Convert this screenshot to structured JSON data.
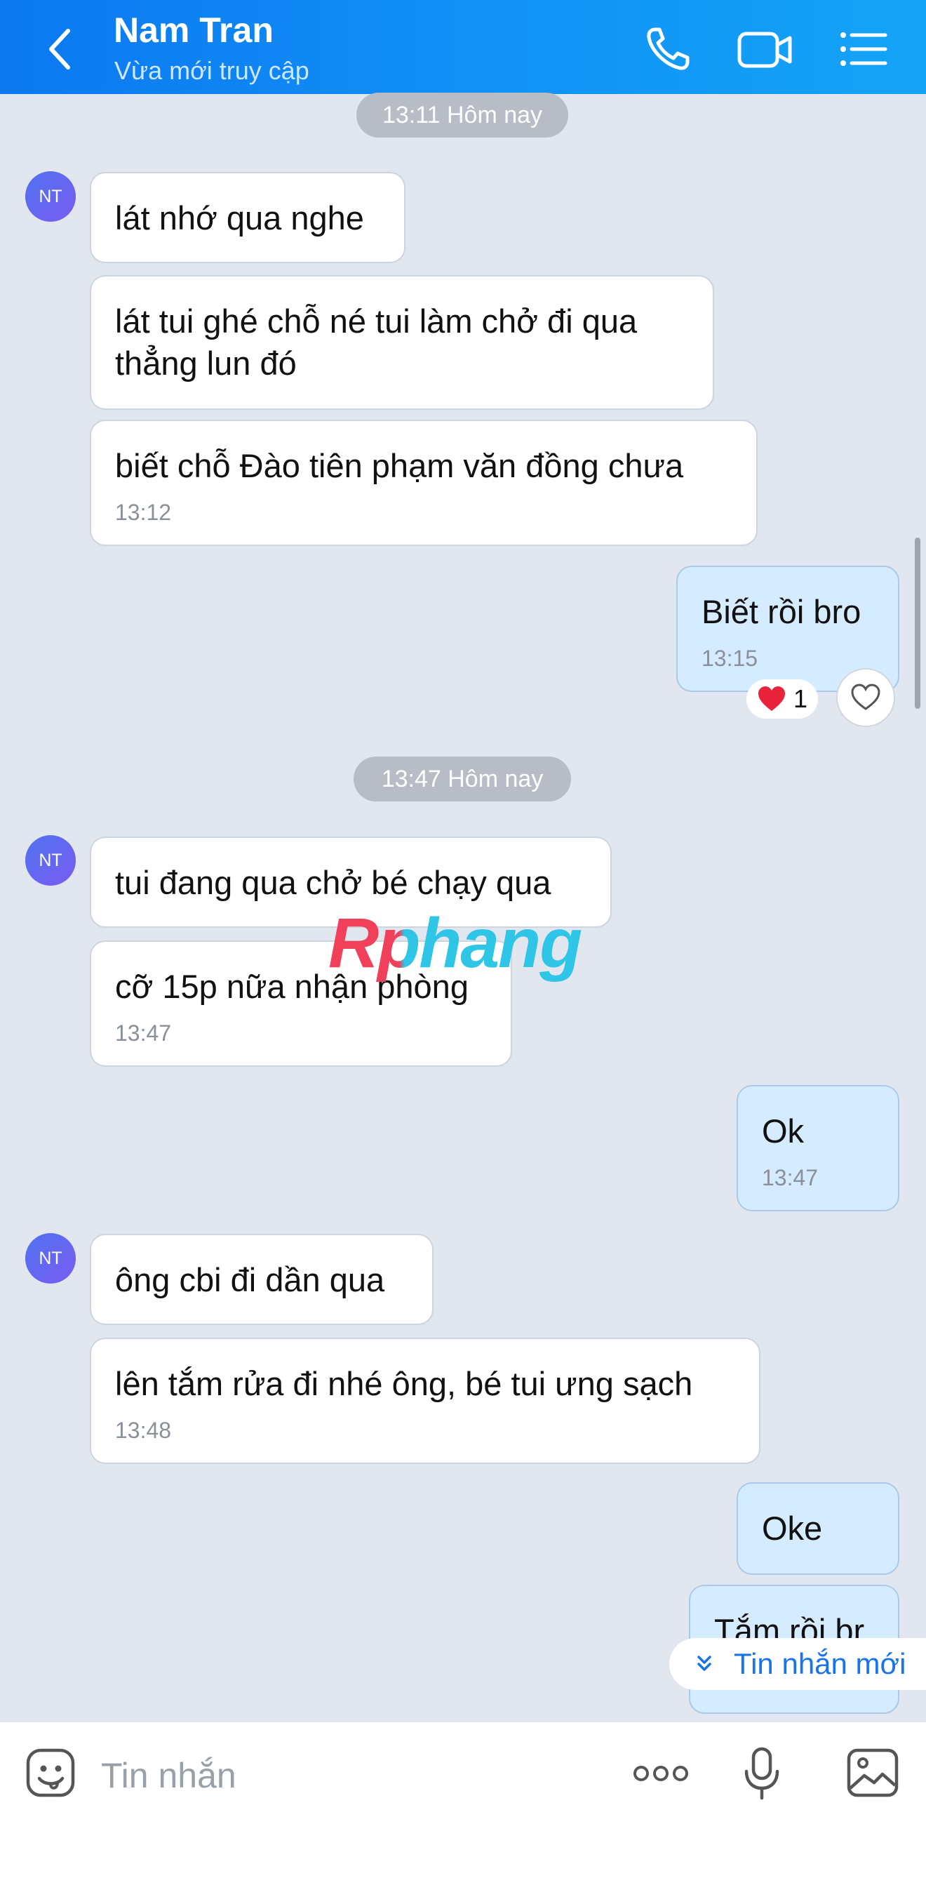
{
  "header": {
    "contact_name": "Nam Tran",
    "status": "Vừa mới truy cập",
    "icons": [
      "back-arrow-icon",
      "phone-icon",
      "video-call-icon",
      "menu-list-icon"
    ],
    "color": "#0b78f0"
  },
  "timestamps": [
    "13:11 Hôm nay",
    "13:47 Hôm nay"
  ],
  "avatar_initials": "NT",
  "messages": [
    {
      "sender": "them",
      "text": "lát nhớ qua nghe",
      "time": ""
    },
    {
      "sender": "them",
      "text": "lát tui ghé chỗ né tui làm chở đi qua thẳng lun đó",
      "time": ""
    },
    {
      "sender": "them",
      "text": "biết chỗ Đào tiên phạm văn đồng chưa",
      "time": "13:12"
    },
    {
      "sender": "me",
      "text": "Biết rồi bro",
      "time": "13:15"
    },
    {
      "sender": "them",
      "text": "tui đang qua chở bé chạy qua",
      "time": ""
    },
    {
      "sender": "them",
      "text": "cỡ 15p nữa nhận phòng",
      "time": "13:47"
    },
    {
      "sender": "me",
      "text": "Ok",
      "time": "13:47"
    },
    {
      "sender": "them",
      "text": "ông cbi đi dần qua",
      "time": ""
    },
    {
      "sender": "them",
      "text": "lên tắm rửa đi nhé ông, bé tui ưng sạch",
      "time": "13:48"
    },
    {
      "sender": "me",
      "text": "Oke",
      "time": ""
    },
    {
      "sender": "me",
      "text": "Tắm rồi br",
      "time": ""
    }
  ],
  "reaction": {
    "emoji": "❤️",
    "count": "1"
  },
  "watermark": "Rphang",
  "new_message_label": "Tin nhắn mới",
  "composer": {
    "placeholder": "Tin nhắn",
    "icons": [
      "sticker-icon",
      "more-dots-icon",
      "microphone-icon",
      "image-icon"
    ]
  },
  "colors": {
    "my_bubble": "#d5ebff",
    "their_bubble": "#ffffff",
    "background": "#e2e6ef",
    "accent": "#1a73e8"
  }
}
